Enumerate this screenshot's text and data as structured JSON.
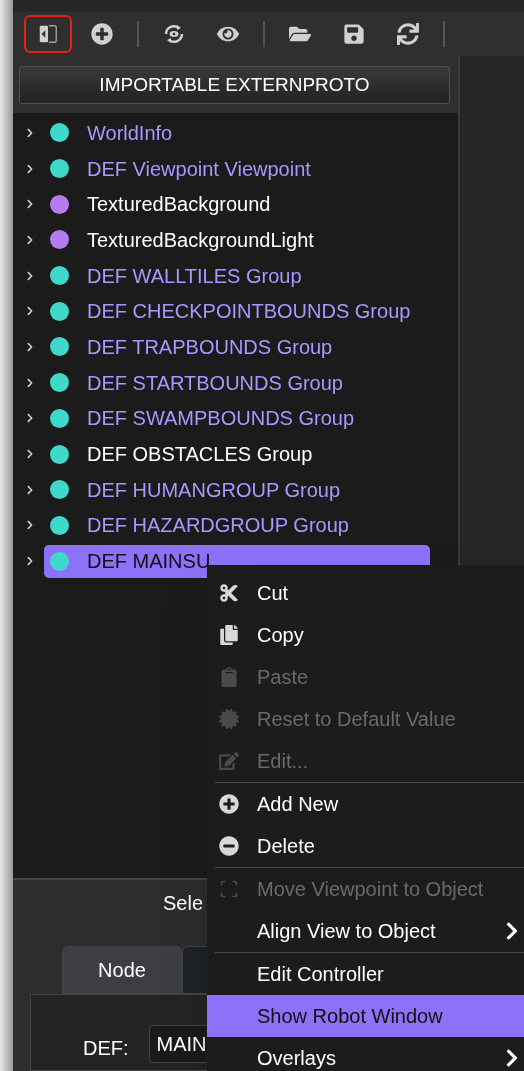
{
  "toolbar": [
    {
      "kind": "panel",
      "selected": true
    },
    {
      "kind": "add",
      "selected": false
    },
    {
      "kind": "sep"
    },
    {
      "kind": "view-sync",
      "selected": false
    },
    {
      "kind": "eye",
      "selected": false
    },
    {
      "kind": "sep"
    },
    {
      "kind": "folder",
      "selected": false
    },
    {
      "kind": "save",
      "selected": false
    },
    {
      "kind": "reload",
      "selected": false
    },
    {
      "kind": "sep"
    }
  ],
  "import_button": "IMPORTABLE EXTERNPROTO",
  "tree": [
    {
      "label": "WorldInfo",
      "color": "#3fd9cc",
      "highlighted": true,
      "selected": false
    },
    {
      "label": "DEF Viewpoint Viewpoint",
      "color": "#3fd9cc",
      "highlighted": true,
      "selected": false
    },
    {
      "label": "TexturedBackground",
      "color": "#b57cf0",
      "highlighted": false,
      "selected": false
    },
    {
      "label": "TexturedBackgroundLight",
      "color": "#b57cf0",
      "highlighted": false,
      "selected": false
    },
    {
      "label": "DEF WALLTILES Group",
      "color": "#3fd9cc",
      "highlighted": true,
      "selected": false
    },
    {
      "label": "DEF CHECKPOINTBOUNDS Group",
      "color": "#3fd9cc",
      "highlighted": true,
      "selected": false
    },
    {
      "label": "DEF TRAPBOUNDS Group",
      "color": "#3fd9cc",
      "highlighted": true,
      "selected": false
    },
    {
      "label": "DEF STARTBOUNDS Group",
      "color": "#3fd9cc",
      "highlighted": true,
      "selected": false
    },
    {
      "label": "DEF SWAMPBOUNDS Group",
      "color": "#3fd9cc",
      "highlighted": true,
      "selected": false
    },
    {
      "label": "DEF OBSTACLES Group",
      "color": "#3fd9cc",
      "highlighted": false,
      "selected": false
    },
    {
      "label": "DEF HUMANGROUP Group",
      "color": "#3fd9cc",
      "highlighted": true,
      "selected": false
    },
    {
      "label": "DEF HAZARDGROUP Group",
      "color": "#3fd9cc",
      "highlighted": true,
      "selected": false
    },
    {
      "label": "DEF MAINSU",
      "color": "#3fd9cc",
      "selected": true
    }
  ],
  "bottom_panel": {
    "title": "Sele",
    "tabs": [
      {
        "label": "Node",
        "selected": true
      },
      {
        "selected": false
      }
    ],
    "def_label": "DEF:",
    "def_value": "MAIN"
  },
  "context_menu": [
    {
      "kind": "scissors",
      "label": "Cut",
      "disabled": false,
      "submenu": false,
      "selected": false
    },
    {
      "kind": "copy",
      "label": "Copy",
      "disabled": false,
      "submenu": false,
      "selected": false
    },
    {
      "kind": "paste",
      "label": "Paste",
      "disabled": true,
      "submenu": false,
      "selected": false
    },
    {
      "kind": "reset",
      "label": "Reset to Default Value",
      "disabled": true,
      "submenu": false,
      "selected": false
    },
    {
      "kind": "edit",
      "label": "Edit...",
      "disabled": true,
      "submenu": false,
      "selected": false
    },
    {
      "kind": "separator"
    },
    {
      "kind": "plus",
      "label": "Add New",
      "disabled": false,
      "submenu": false,
      "selected": false
    },
    {
      "kind": "minus",
      "label": "Delete",
      "disabled": false,
      "submenu": false,
      "selected": false
    },
    {
      "kind": "separator"
    },
    {
      "kind": "frame",
      "label": "Move Viewpoint to Object",
      "disabled": true,
      "submenu": false,
      "selected": false
    },
    {
      "kind": "plain",
      "label": "Align View to Object",
      "disabled": false,
      "submenu": true,
      "selected": false
    },
    {
      "kind": "separator"
    },
    {
      "kind": "plain",
      "label": "Edit Controller",
      "disabled": false,
      "submenu": false,
      "selected": false
    },
    {
      "kind": "plain",
      "label": "Show Robot Window",
      "disabled": false,
      "submenu": false,
      "selected": true
    },
    {
      "kind": "plain",
      "label": "Overlays",
      "disabled": false,
      "submenu": true,
      "selected": false
    }
  ]
}
